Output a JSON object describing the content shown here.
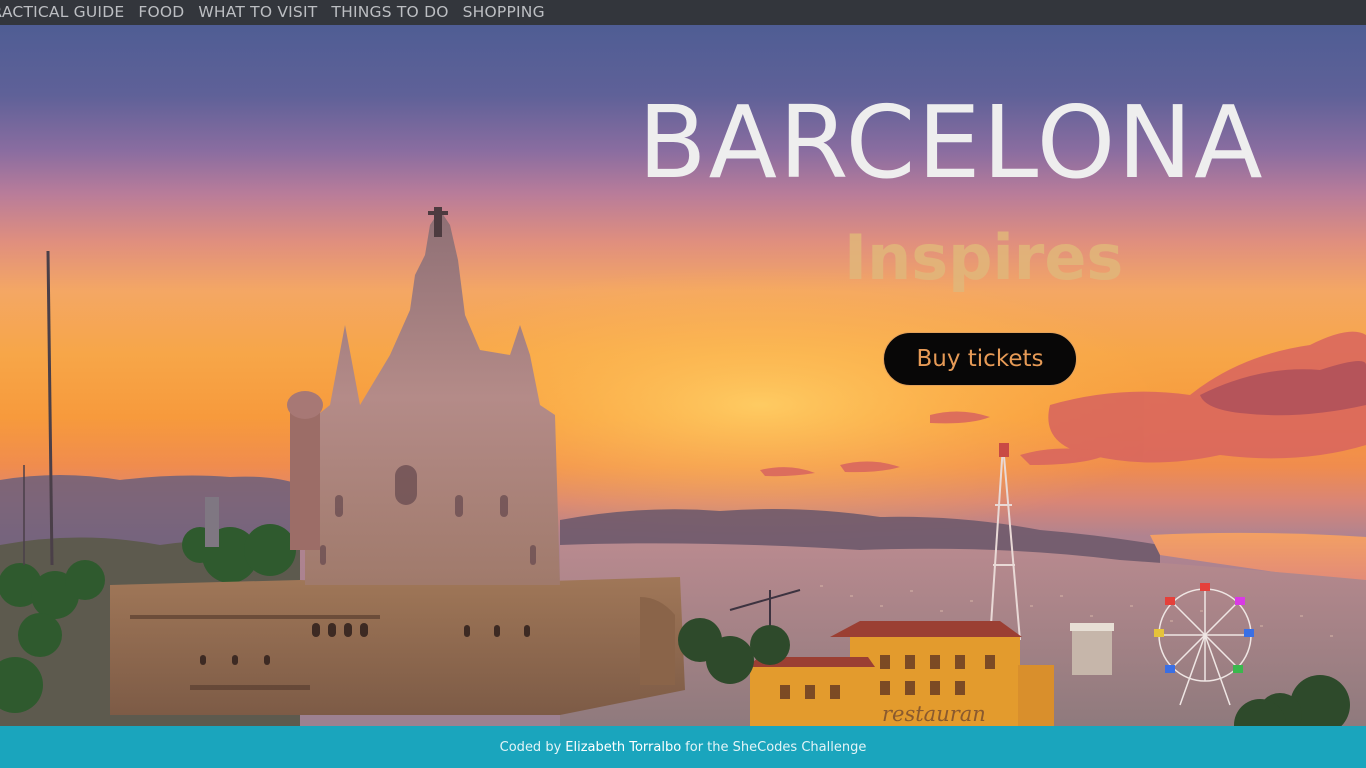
{
  "nav": {
    "items": [
      {
        "label": "PRACTICAL GUIDE"
      },
      {
        "label": "FOOD"
      },
      {
        "label": "WHAT TO VISIT"
      },
      {
        "label": "THINGS TO DO"
      },
      {
        "label": "SHOPPING"
      }
    ]
  },
  "hero": {
    "title": "BARCELONA",
    "subtitle": "Inspires",
    "buy_button_label": "Buy tickets",
    "photo_sign_text": "restauran",
    "colors": {
      "title": "#eeeeee",
      "subtitle": "#e1b77a",
      "button_bg": "#080707",
      "button_text": "#e69a56"
    }
  },
  "footer": {
    "prefix": "Coded by",
    "author": "Elizabeth Torralbo",
    "suffix": "for the SheCodes Challenge",
    "background": "#1aa5bd"
  }
}
